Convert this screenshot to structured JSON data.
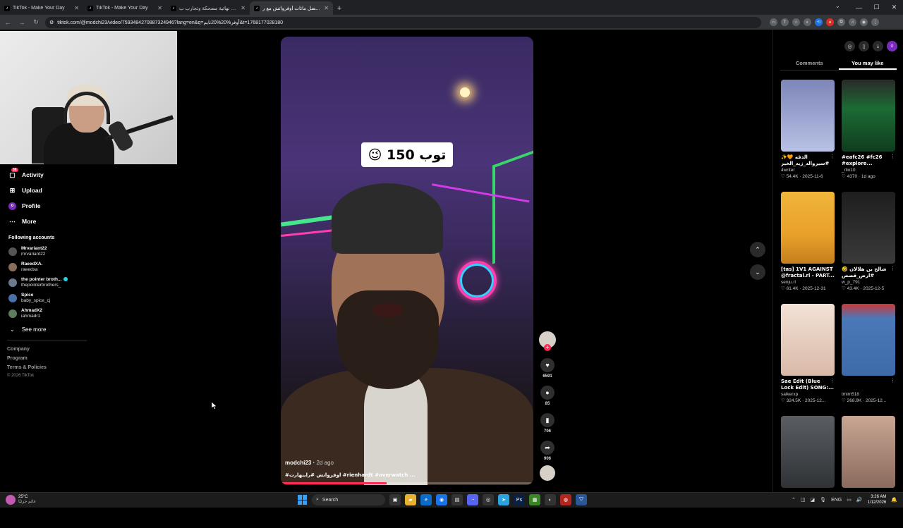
{
  "browser": {
    "tabs": [
      {
        "title": "TikTok - Make Your Day",
        "active": false
      },
      {
        "title": "TikTok - Make Your Day",
        "active": false
      },
      {
        "title": "اختيارات نهائية مضحكة وتجارب ب...",
        "active": false
      },
      {
        "title": "أفضل ماتات أوفرواتش مع ر...",
        "active": true
      }
    ],
    "new_tab_label": "+",
    "url": "tiktok.com/@modchi23/video/7593484270887324946?lang=en&q=أوفر%20%20نايم&t=1768177028180"
  },
  "sidebar": {
    "nav": [
      {
        "label": "Activity",
        "icon": "activity-icon",
        "badge": "36"
      },
      {
        "label": "Upload",
        "icon": "upload-icon"
      },
      {
        "label": "Profile",
        "icon": "profile-avatar",
        "avatar_letter": "o"
      },
      {
        "label": "More",
        "icon": "more-icon"
      }
    ],
    "following_title": "Following accounts",
    "accounts": [
      {
        "name": "Mrvariant22",
        "user": "mrvariant22",
        "verified": false
      },
      {
        "name": "RaeedXA.",
        "user": "raeedxa",
        "verified": false
      },
      {
        "name": "the pointer broth...",
        "user": "thepointerbrothers_",
        "verified": true
      },
      {
        "name": "Spice",
        "user": "baby_spice_cj",
        "verified": false
      },
      {
        "name": "AhmadX2",
        "user": "iahmadr1",
        "verified": false
      }
    ],
    "see_more": "See more",
    "footer_links": [
      "Company",
      "Program",
      "Terms & Policies"
    ],
    "copyright": "© 2026 TikTok"
  },
  "video": {
    "caption": "توب 150 😉",
    "author": "modchi23",
    "posted": "2d ago",
    "description": "#اوفرواتش #راينهارت #rienhardt #overwatch ...",
    "progress": 0.42
  },
  "actions": {
    "likes": "6591",
    "comments": "85",
    "saves": "706",
    "shares": "906"
  },
  "right_panel": {
    "tabs": [
      "Comments",
      "You may like"
    ],
    "active_tab": "You may like",
    "cards": [
      {
        "title": "✨🧡 الدقه #سيروالد_زيد_الخير",
        "user": "4writer",
        "likes": "54.4K",
        "date": "2025-11-6",
        "thumb_color": "#8a8fb8"
      },
      {
        "title": "#eafc26 #fc26 #explore...",
        "user": "_rlio10",
        "likes": "4370",
        "date": "1d ago",
        "thumb_color": "#1f4a2a"
      },
      {
        "title": "[tas] 1V1 AGAINST @fractal.rl - PART...",
        "user": "senju.rl",
        "likes": "61.4K",
        "date": "2025-12-31",
        "thumb_color": "#e2a529"
      },
      {
        "title": "شالح بن هلالان 🤣 #ارض_قصص",
        "user": "w_p_791",
        "likes": "43.4K",
        "date": "2025-12-5",
        "thumb_color": "#2c2c2c"
      },
      {
        "title": "Sae Edit (Blue Lock Edit) SONG:...",
        "user": "saikerxp",
        "likes": "324.5K",
        "date": "2025-12...",
        "thumb_color": "#e9d3c6"
      },
      {
        "title": "",
        "user": "tmim518",
        "likes": "268.9K",
        "date": "2025-12...",
        "thumb_color": "#3d6aa8"
      },
      {
        "title": "",
        "user": "",
        "likes": "",
        "date": "",
        "thumb_color": "#4a4e52"
      },
      {
        "title": "",
        "user": "",
        "likes": "",
        "date": "",
        "thumb_color": "#b08a78"
      }
    ]
  },
  "taskbar": {
    "temp": "25°C",
    "weather_sub": "غائم جزئيًا",
    "search_label": "Search",
    "lang": "ENG",
    "time": "3:26 AM",
    "date": "1/12/2026"
  },
  "colors": {
    "accent": "#fe2c55",
    "verified": "#20d5ec",
    "profile": "#7b2cbf"
  }
}
